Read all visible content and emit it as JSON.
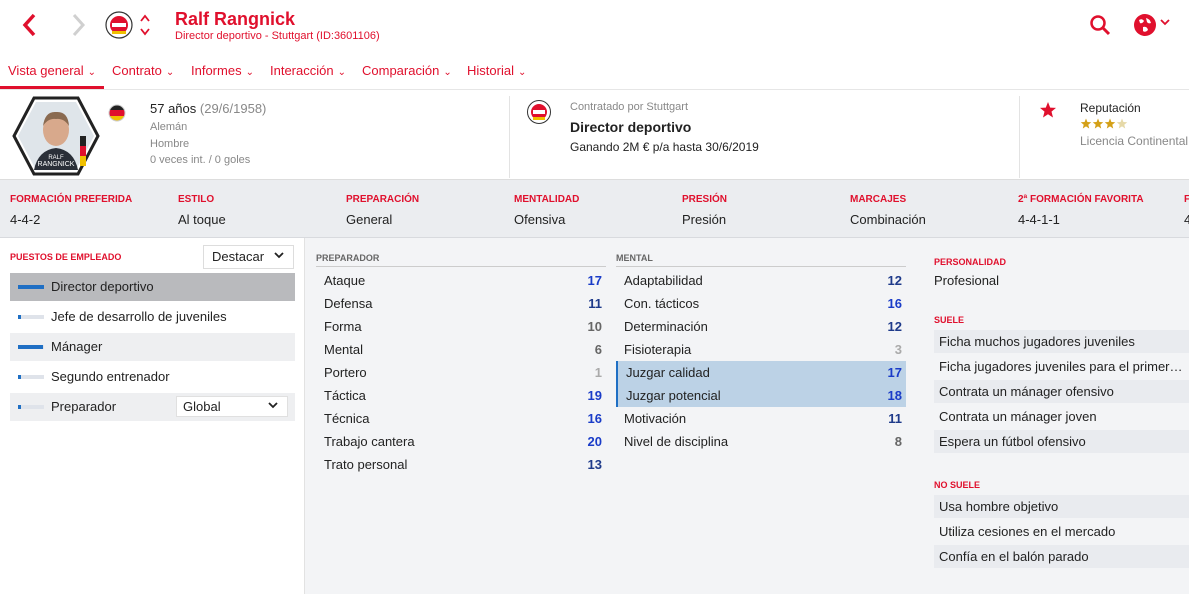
{
  "header": {
    "name": "Ralf Rangnick",
    "subtitle": "Director deportivo - Stuttgart (ID:3601106)",
    "accent": "#e0102d",
    "icons": {
      "back": "chevron-left-icon",
      "forward": "chevron-right-icon",
      "search": "search-icon",
      "globe": "globe-icon"
    }
  },
  "tabs": [
    {
      "label": "Vista general",
      "active": true
    },
    {
      "label": "Contrato"
    },
    {
      "label": "Informes"
    },
    {
      "label": "Interacción"
    },
    {
      "label": "Comparación"
    },
    {
      "label": "Historial"
    }
  ],
  "profile": {
    "age": "57 años",
    "dob": "(29/6/1958)",
    "nationality": "Alemán",
    "gender": "Hombre",
    "caps": "0 veces int. / 0 goles",
    "avatar_caption_small": "RALF",
    "avatar_caption": "RANGNICK"
  },
  "contract": {
    "hired_by": "Contratado por Stuttgart",
    "role": "Director deportivo",
    "terms": "Ganando 2M € p/a hasta 30/6/2019"
  },
  "reputation": {
    "title": "Reputación",
    "stars": 3.5,
    "stars_text": "★★★★",
    "level": "Licencia Continental"
  },
  "tactics": [
    {
      "label": "FORMACIÓN PREFERIDA",
      "value": "4-4-2"
    },
    {
      "label": "ESTILO",
      "value": "Al toque"
    },
    {
      "label": "PREPARACIÓN",
      "value": "General"
    },
    {
      "label": "MENTALIDAD",
      "value": "Ofensiva"
    },
    {
      "label": "PRESIÓN",
      "value": "Presión"
    },
    {
      "label": "MARCAJES",
      "value": "Combinación"
    },
    {
      "label": "2ª FORMACIÓN FAVORITA",
      "value": "4-4-1-1"
    },
    {
      "label": "F",
      "value": "4"
    }
  ],
  "roles": {
    "title": "PUESTOS DE EMPLEADO",
    "highlight_select": "Destacar",
    "items": [
      {
        "label": "Director deportivo",
        "level": 1.0
      },
      {
        "label": "Jefe de desarrollo de juveniles",
        "level": 0.1
      },
      {
        "label": "Mánager",
        "level": 0.95
      },
      {
        "label": "Segundo entrenador",
        "level": 0.1
      },
      {
        "label": "Preparador",
        "level": 0.1,
        "select": "Global"
      }
    ]
  },
  "coaching": {
    "title": "PREPARADOR",
    "attributes": [
      {
        "name": "Ataque",
        "value": "17"
      },
      {
        "name": "Defensa",
        "value": "11"
      },
      {
        "name": "Forma",
        "value": "10"
      },
      {
        "name": "Mental",
        "value": "6"
      },
      {
        "name": "Portero",
        "value": "1"
      },
      {
        "name": "Táctica",
        "value": "19"
      },
      {
        "name": "Técnica",
        "value": "16"
      },
      {
        "name": "Trabajo cantera",
        "value": "20"
      },
      {
        "name": "Trato personal",
        "value": "13"
      }
    ]
  },
  "mental": {
    "title": "MENTAL",
    "attributes": [
      {
        "name": "Adaptabilidad",
        "value": "12"
      },
      {
        "name": "Con. tácticos",
        "value": "16"
      },
      {
        "name": "Determinación",
        "value": "12"
      },
      {
        "name": "Fisioterapia",
        "value": "3"
      },
      {
        "name": "Juzgar calidad",
        "value": "17",
        "highlighted": true
      },
      {
        "name": "Juzgar potencial",
        "value": "18",
        "highlighted": true
      },
      {
        "name": "Motivación",
        "value": "11"
      },
      {
        "name": "Nivel de disciplina",
        "value": "8"
      }
    ]
  },
  "personality": {
    "title": "PERSONALIDAD",
    "value": "Profesional",
    "tends_title": "SUELE",
    "tends": [
      "Ficha muchos jugadores juveniles",
      "Ficha jugadores juveniles para el primer…",
      "Contrata un mánager ofensivo",
      "Contrata un mánager joven",
      "Espera un fútbol ofensivo"
    ],
    "not_tends_title": "NO SUELE",
    "not_tends": [
      "Usa hombre objetivo",
      "Utiliza cesiones en el mercado",
      "Confía en el balón parado"
    ]
  }
}
